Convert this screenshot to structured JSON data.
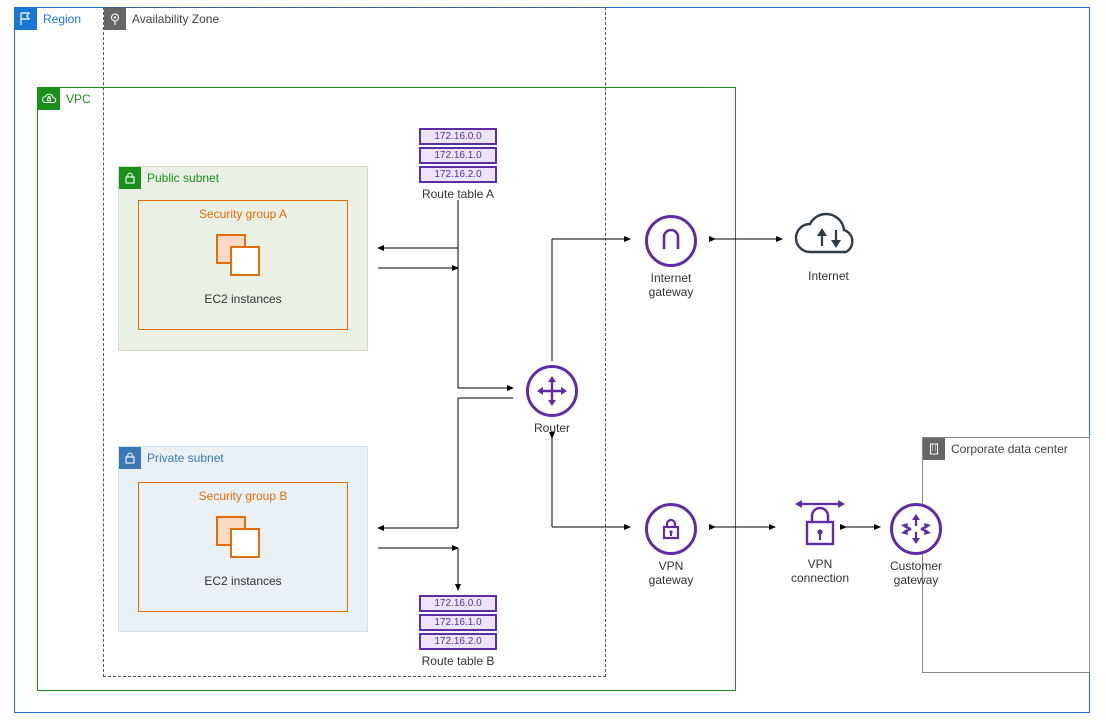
{
  "region": {
    "label": "Region"
  },
  "az": {
    "label": "Availability Zone"
  },
  "vpc": {
    "label": "VPC"
  },
  "public_subnet": {
    "label": "Public subnet",
    "sg_label": "Security group A",
    "instances_label": "EC2 instances"
  },
  "private_subnet": {
    "label": "Private subnet",
    "sg_label": "Security group B",
    "instances_label": "EC2 instances"
  },
  "route_table_a": {
    "label": "Route table A",
    "routes": [
      "172.16.0.0",
      "172.16.1.0",
      "172.16.2.0"
    ]
  },
  "route_table_b": {
    "label": "Route table B",
    "routes": [
      "172.16.0.0",
      "172.16.1.0",
      "172.16.2.0"
    ]
  },
  "router": {
    "label": "Router"
  },
  "igw": {
    "label": "Internet\ngateway"
  },
  "vpngw": {
    "label": "VPN\ngateway"
  },
  "internet": {
    "label": "Internet"
  },
  "vpnconn": {
    "label": "VPN\nconnection"
  },
  "cgw": {
    "label": "Customer\ngateway"
  },
  "cdc": {
    "label": "Corporate data center"
  }
}
